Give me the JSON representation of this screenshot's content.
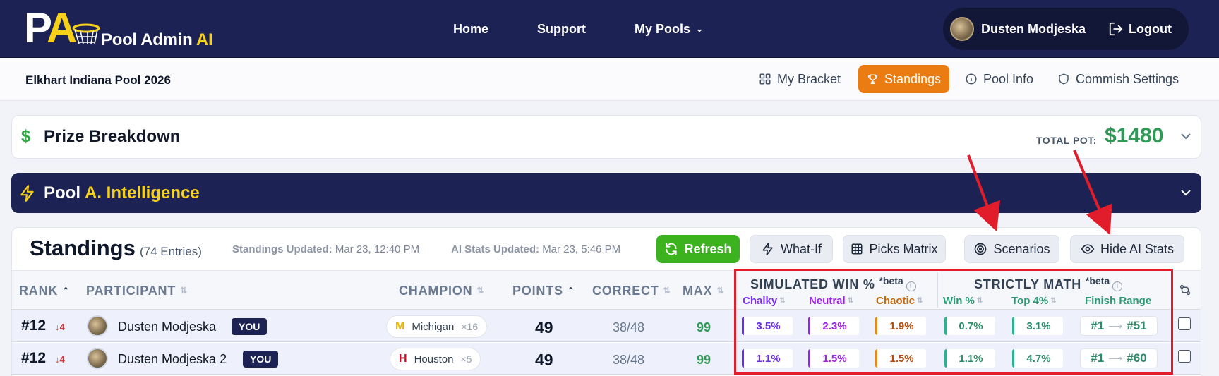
{
  "nav": {
    "logo_text": "Pool Admin",
    "logo_ai": "AI",
    "links": [
      "Home",
      "Support",
      "My Pools"
    ],
    "user_name": "Dusten Modjeska",
    "logout": "Logout"
  },
  "subnav": {
    "pool_name": "Elkhart Indiana Pool 2026",
    "tabs": [
      "My Bracket",
      "Standings",
      "Pool Info",
      "Commish Settings"
    ],
    "active_tab": "Standings"
  },
  "prize": {
    "title": "Prize Breakdown",
    "pot_label": "TOTAL POT:",
    "pot_value": "$1480"
  },
  "pool_ai": {
    "title": "Pool",
    "title_accent": "A. Intelligence"
  },
  "standings": {
    "title": "Standings",
    "count": "(74 Entries)",
    "standings_updated_label": "Standings Updated:",
    "standings_updated": "Mar 23, 12:40 PM",
    "ai_updated_label": "AI Stats Updated:",
    "ai_updated": "Mar 23, 5:46 PM",
    "buttons": [
      "Refresh",
      "What-If",
      "Picks Matrix",
      "Scenarios",
      "Hide AI Stats"
    ],
    "columns": [
      "RANK",
      "PARTICIPANT",
      "CHAMPION",
      "POINTS",
      "CORRECT",
      "MAX"
    ],
    "group_sim": "SIMULATED WIN %",
    "group_math": "STRICTLY MATH",
    "beta": "*beta",
    "sub_columns": [
      "Chalky",
      "Neutral",
      "Chaotic",
      "Win %",
      "Top 4%",
      "Finish Range"
    ],
    "rows": [
      {
        "rank": "#12",
        "delta": "↓4",
        "name": "Dusten Modjeska",
        "badge": "YOU",
        "champion": "Michigan",
        "champion_count": "×16",
        "points": "49",
        "correct": "38/48",
        "max": "99",
        "chalky": "3.5%",
        "neutral": "2.3%",
        "chaotic": "1.9%",
        "win": "0.7%",
        "top4": "3.1%",
        "finish_from": "#1",
        "finish_to": "#51"
      },
      {
        "rank": "#12",
        "delta": "↓4",
        "name": "Dusten Modjeska 2",
        "badge": "YOU",
        "champion": "Houston",
        "champion_count": "×5",
        "points": "49",
        "correct": "38/48",
        "max": "99",
        "chalky": "1.1%",
        "neutral": "1.5%",
        "chaotic": "1.5%",
        "win": "1.1%",
        "top4": "4.7%",
        "finish_from": "#1",
        "finish_to": "#60"
      }
    ]
  },
  "colors": {
    "navy": "#1c2354",
    "accent_orange": "#ea7c12",
    "refresh_green": "#3cb31e",
    "logo_yellow": "#f7d117",
    "annotation_red": "#e11d2b"
  },
  "icons": [
    "logo-icon",
    "chevron-down-icon",
    "logout-icon",
    "grid-icon",
    "trophy-icon",
    "info-icon",
    "shield-icon",
    "dollar-icon",
    "bolt-icon",
    "refresh-icon",
    "table-icon",
    "target-icon",
    "eye-icon",
    "compare-icon"
  ]
}
